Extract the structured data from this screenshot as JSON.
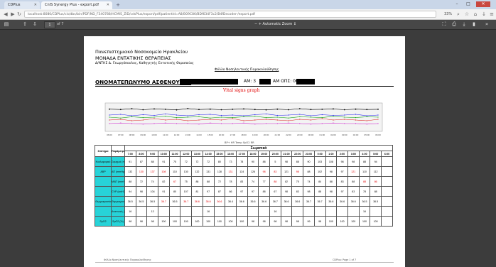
{
  "browser": {
    "tabs": [
      {
        "label": "CDPlus",
        "active": false
      },
      {
        "label": "CnIS Synergy Plus - export.pdf",
        "active": true
      }
    ],
    "new_tab_label": "+",
    "window_buttons": {
      "minimize": "–",
      "maximize": "□",
      "close": "✕"
    },
    "url": "localhost:8080/CDPlus/cis/dbs/bin/PDF/ND_F340788/HCMIS_ZID/cdsPlus/export/pdf/patientId=A8/B09C86/BDf634F3c2/B4fDecoder-/export.pdf",
    "zoom_label": "33%",
    "icons": [
      "back-icon",
      "forward-icon",
      "reload-icon",
      "search-icon",
      "star-icon",
      "home-icon",
      "download-icon",
      "menu-icon"
    ]
  },
  "pdf_toolbar": {
    "page_current": "1",
    "page_total": "of 7",
    "zoom_mode": "− + Automatic Zoom ↕",
    "icons": [
      "sidebar-toggle-icon",
      "prev-page-icon",
      "next-page-icon",
      "zoom-out-icon",
      "zoom-in-icon",
      "presentation-icon",
      "print-icon",
      "save-icon",
      "bookmark-icon",
      "tools-icon"
    ]
  },
  "document": {
    "hospital": "Πανεπιστημιακό Νοσοκομείο Ηρακλείου",
    "unit": "ΜΟΝΑΔΑ ΕΝΤΑΤΙΚΗΣ ΘΕΡΑΠΕΙΑΣ",
    "director": "Δ/ΝΤΗΣ Δ. Γεωργόπουλος, Καθηγητής Εντατικής Θεραπείας",
    "sheet_title": "Φύλλο Νοσηλευτικής Παρακολούθησης",
    "patient_label": "ΟΝΟΜΑΤΕΠΩΝΥΜΟ ΑΣΘΕΝΟΥΣ: Φ",
    "am_label": "ΑΜ: 3",
    "amos_label": "ΑΜ ΟΠΣ: 0000",
    "graph_title": "Vital signs graph",
    "legend_text": "BP+  HR  Temp  SpO2  RR",
    "footer_left": "Φύλλο Νοσηλευτικής Παρακολούθησης",
    "footer_right": "CDPlus: Page 1 of 7"
  },
  "chart_data": {
    "type": "line",
    "title": "Vital signs graph",
    "x": [
      "06:00",
      "07:00",
      "08:00",
      "09:00",
      "10:00",
      "11:00",
      "12:00",
      "13:00",
      "14:00",
      "15:00",
      "16:00",
      "17:00",
      "18:00",
      "19:00",
      "20:00",
      "21:00",
      "22:00",
      "23:00",
      "00:00",
      "01:00",
      "02:00",
      "03:00",
      "04:00",
      "05:00",
      "06:00"
    ],
    "series": [
      {
        "name": "SBP",
        "color": "#000000",
        "values": [
          130,
          128,
          132,
          127,
          131,
          129,
          126,
          133,
          128,
          130,
          127,
          129,
          131,
          128,
          126,
          130,
          127,
          132,
          128,
          129,
          131,
          127,
          130,
          128,
          129
        ]
      },
      {
        "name": "HR",
        "color": "#2222ee",
        "values": [
          90,
          92,
          88,
          91,
          89,
          93,
          90,
          88,
          91,
          92,
          89,
          90,
          88,
          91,
          93,
          89,
          90,
          92,
          88,
          91,
          89,
          90,
          92,
          88,
          90
        ]
      },
      {
        "name": "Temp",
        "color": "#22aa22",
        "values": [
          37,
          36.8,
          37.1,
          36.9,
          37,
          37.2,
          36.9,
          37,
          37.1,
          36.8,
          37,
          36.9,
          37.1,
          37.2,
          36.9,
          37,
          36.8,
          37.1,
          37,
          36.9,
          37.2,
          37,
          36.9,
          37.1,
          37
        ]
      },
      {
        "name": "SpO2",
        "color": "#dd2222",
        "values": [
          96,
          97,
          95,
          96,
          98,
          96,
          97,
          95,
          96,
          97,
          96,
          98,
          95,
          96,
          97,
          96,
          95,
          97,
          96,
          98,
          96,
          97,
          96,
          95,
          97
        ]
      },
      {
        "name": "RR",
        "color": "#cc22cc",
        "values": [
          18,
          19,
          18,
          17,
          18,
          19,
          18,
          18,
          17,
          19,
          18,
          18,
          19,
          17,
          18,
          18,
          19,
          18,
          17,
          18,
          19,
          18,
          18,
          17,
          18
        ]
      }
    ]
  },
  "table": {
    "header_group": "Σωματικά",
    "col_label_1": "Σύστημα",
    "col_label_2": "Παράμετρος",
    "day_label": "Σωματικά",
    "times": [
      "7:00",
      "8:00",
      "9:00",
      "10:00",
      "11:00",
      "12:00",
      "13:00",
      "14:00",
      "15:00",
      "16:00",
      "17:00",
      "18:00",
      "19:00",
      "20:00",
      "21:00",
      "22:00",
      "23:00",
      "0:00",
      "1:00",
      "2:00",
      "3:00",
      "4:00",
      "5:00",
      "6:00"
    ],
    "rows": [
      {
        "system": "Κυκλοφορικό",
        "param": "Σφυγμοί (παλμοί/min)",
        "values": [
          "91",
          "87",
          "88",
          "91",
          "75",
          "72",
          "72",
          "72",
          "80",
          "73",
          "78",
          "90",
          "88",
          "5",
          "98",
          "88",
          "90",
          "103",
          "108",
          "98",
          "98",
          "88",
          "94"
        ],
        "red": []
      },
      {
        "system": "ABP",
        "param": "ΑΠ (mmHg)",
        "values": [
          "132",
          "130",
          "137",
          "108",
          "110",
          "130",
          "132",
          "131",
          "128",
          "131",
          "124",
          "126",
          "98",
          "83",
          "121",
          "98",
          "88",
          "102",
          "98",
          "97",
          "121",
          "110",
          "112"
        ],
        "red": [
          1,
          2,
          3,
          9,
          12,
          13,
          15,
          20
        ]
      },
      {
        "system": "",
        "param": "ΜΑΠ (mmHg)",
        "values": [
          "88",
          "72",
          "74",
          "82",
          "67",
          "75",
          "88",
          "88",
          "72",
          "78",
          "83",
          "74",
          "77",
          "88",
          "82",
          "75",
          "74",
          "84",
          "88",
          "83",
          "88",
          "88",
          "86"
        ],
        "red": [
          4,
          13,
          21,
          22
        ]
      },
      {
        "system": "",
        "param": "CVP (cmH2O)",
        "values": [
          "94",
          "98",
          "104",
          "91",
          "80",
          "107",
          "81",
          "97",
          "87",
          "86",
          "97",
          "97",
          "88",
          "67",
          "98",
          "83",
          "98",
          "88",
          "98",
          "97",
          "83",
          "78",
          "88"
        ],
        "red": []
      },
      {
        "system": "Θερμοκρασία",
        "param": "Θερμοκρασία (°C)",
        "values": [
          "36.5",
          "36.5",
          "36.5",
          "36.7",
          "36.5",
          "36.7",
          "36.6",
          "36.6",
          "36.6",
          "36.4",
          "36.6",
          "36.6",
          "36.6",
          "36.7",
          "36.6",
          "36.6",
          "36.7",
          "36.7",
          "36.6",
          "36.6",
          "36.6",
          "36.5",
          "36.5"
        ],
        "red": [
          3,
          5,
          6,
          7,
          8
        ]
      },
      {
        "system": "",
        "param": "Αναπνοές (/min)",
        "values": [
          "16",
          "",
          "13",
          "",
          "",
          "",
          "",
          "16",
          "",
          "",
          "",
          "",
          "",
          "16",
          "",
          "",
          "",
          "",
          "",
          "",
          "",
          "16",
          ""
        ],
        "red": []
      },
      {
        "system": "SpO2",
        "param": "SpO2 (%)",
        "values": [
          "98",
          "98",
          "98",
          "100",
          "100",
          "100",
          "100",
          "100",
          "100",
          "100",
          "100",
          "98",
          "98",
          "98",
          "98",
          "98",
          "99",
          "98",
          "100",
          "100",
          "100",
          "100",
          "100"
        ],
        "red": []
      }
    ]
  },
  "colors": {
    "tab_bar": "#c9d6e8",
    "pdf_viewer_bg": "#3c3c3c",
    "label_cell": "#27d3d8",
    "graph_title": "#e00000",
    "highlight_value": "#e00000"
  }
}
